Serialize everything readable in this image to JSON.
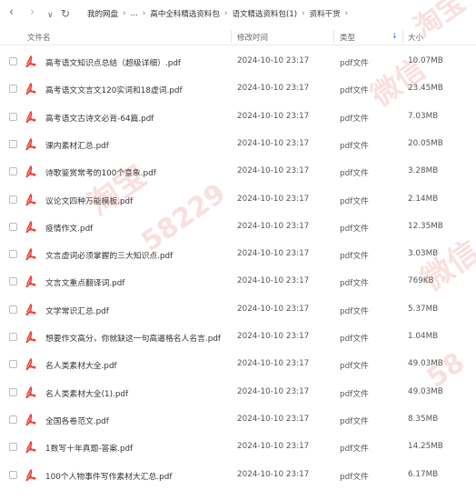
{
  "breadcrumb": {
    "items": [
      "我的网盘",
      "...",
      "高中全科精选资料包",
      "语文精选资料包(1)",
      "资料干货"
    ]
  },
  "columns": {
    "name": "文件名",
    "date": "修改时间",
    "type": "类型",
    "size": "大小"
  },
  "files": [
    {
      "name": "高考语文知识点总结（超级详细）.pdf",
      "date": "2024-10-10 23:17",
      "type": "pdf文件",
      "size": "10.07MB"
    },
    {
      "name": "高考语文文言文120实词和18虚词.pdf",
      "date": "2024-10-10 23:17",
      "type": "pdf文件",
      "size": "23.45MB"
    },
    {
      "name": "高考语文古诗文必背-64篇.pdf",
      "date": "2024-10-10 23:17",
      "type": "pdf文件",
      "size": "7.03MB"
    },
    {
      "name": "课内素材汇总.pdf",
      "date": "2024-10-10 23:17",
      "type": "pdf文件",
      "size": "20.05MB"
    },
    {
      "name": "诗歌鉴赏常考的100个意象.pdf",
      "date": "2024-10-10 23:17",
      "type": "pdf文件",
      "size": "3.28MB"
    },
    {
      "name": "议论文四种万能模板.pdf",
      "date": "2024-10-10 23:17",
      "type": "pdf文件",
      "size": "2.14MB"
    },
    {
      "name": "疫情作文.pdf",
      "date": "2024-10-10 23:17",
      "type": "pdf文件",
      "size": "12.35MB"
    },
    {
      "name": "文言虚词必须掌握的三大知识点.pdf",
      "date": "2024-10-10 23:17",
      "type": "pdf文件",
      "size": "3.03MB"
    },
    {
      "name": "文言文重点翻译词.pdf",
      "date": "2024-10-10 23:17",
      "type": "pdf文件",
      "size": "769KB"
    },
    {
      "name": "文学常识汇总.pdf",
      "date": "2024-10-10 23:17",
      "type": "pdf文件",
      "size": "5.37MB"
    },
    {
      "name": "想要作文高分，你就缺这一句高逼格名人名言.pdf",
      "date": "2024-10-10 23:17",
      "type": "pdf文件",
      "size": "1.04MB"
    },
    {
      "name": "名人类素材大全.pdf",
      "date": "2024-10-10 23:17",
      "type": "pdf文件",
      "size": "49.03MB"
    },
    {
      "name": "名人类素材大全(1).pdf",
      "date": "2024-10-10 23:17",
      "type": "pdf文件",
      "size": "49.03MB"
    },
    {
      "name": "全国各卷范文.pdf",
      "date": "2024-10-10 23:17",
      "type": "pdf文件",
      "size": "8.35MB"
    },
    {
      "name": "1数写十年真题-答案.pdf",
      "date": "2024-10-10 23:17",
      "type": "pdf文件",
      "size": "14.25MB"
    },
    {
      "name": "100个人物事件写作素材大汇总.pdf",
      "date": "2024-10-10 23:17",
      "type": "pdf文件",
      "size": "6.17MB"
    }
  ],
  "watermarks": [
    "淘宝",
    "微信",
    "58229",
    "淘宝",
    "微信",
    "58"
  ],
  "colors": {
    "pdf_icon": "#e8453c",
    "accent": "#2f7cf6",
    "watermark": "#e66e6e"
  },
  "icons": {
    "back": "chevron-left-icon",
    "forward": "chevron-right-icon",
    "dropdown": "chevron-down-icon",
    "refresh": "refresh-icon",
    "file": "pdf-file-icon"
  }
}
